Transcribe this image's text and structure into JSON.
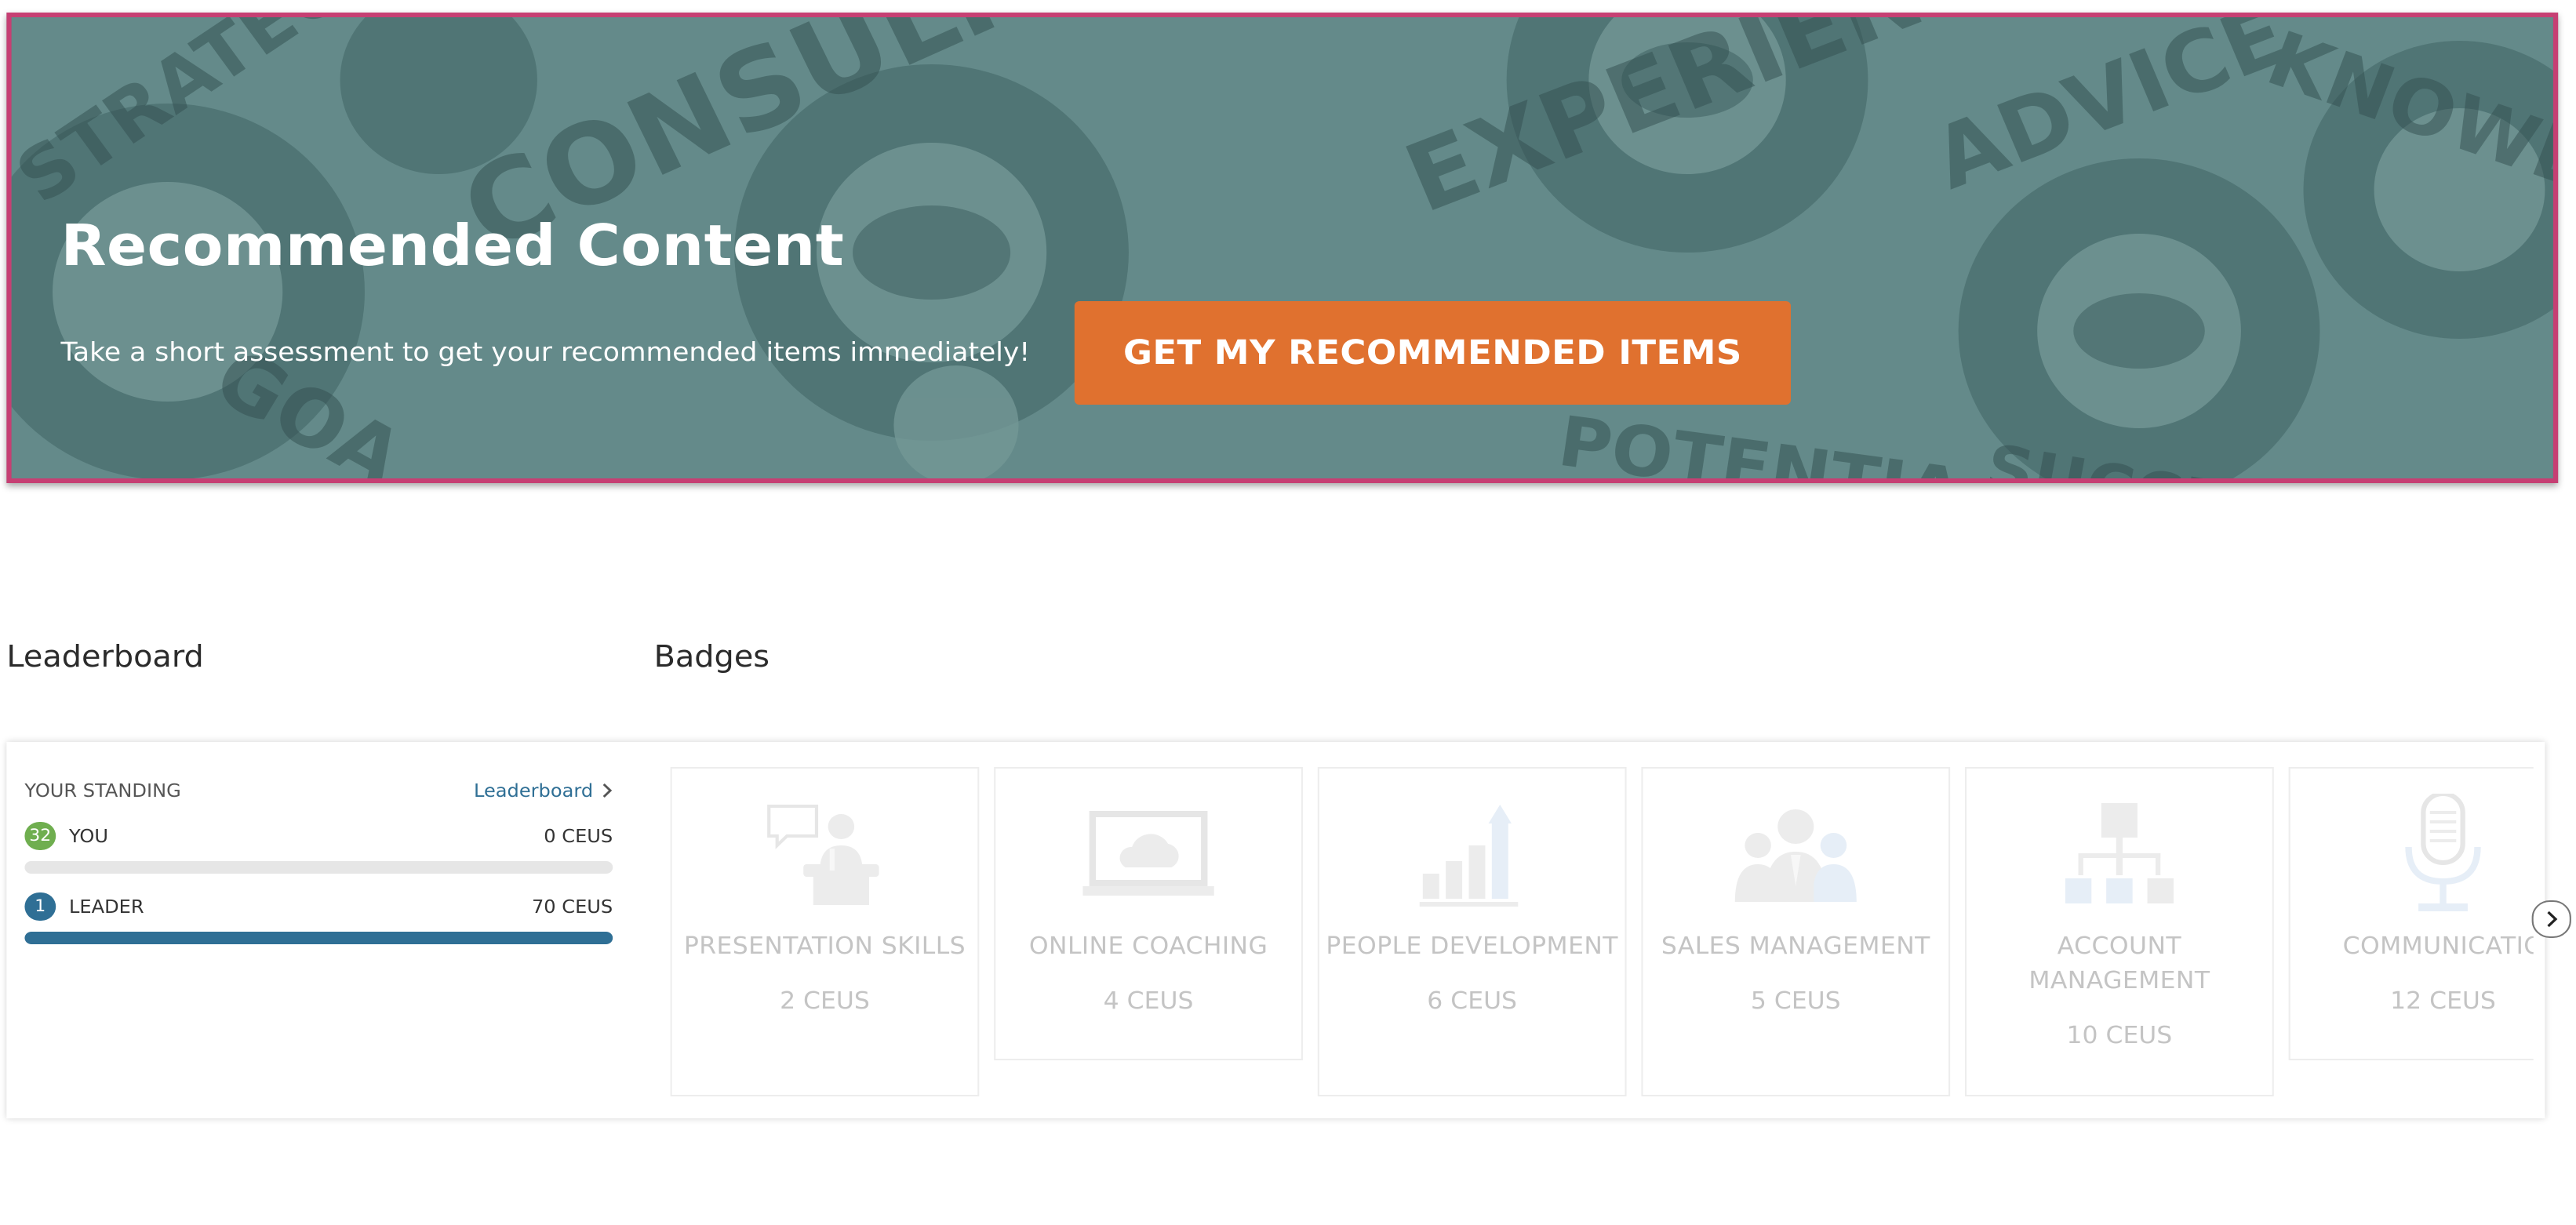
{
  "hero": {
    "title": "Recommended Content",
    "subtitle": "Take a short assessment to get your recommended items immediately!",
    "button_label": "GET MY RECOMMENDED ITEMS",
    "background_words": [
      "STRATEGY",
      "CONSULTING",
      "EXPERIENCE",
      "ADVICE",
      "KNOWLE",
      "GOA",
      "POTENTIA",
      "SUCCES"
    ],
    "colors": {
      "border": "#c63f73",
      "button": "#e0712f",
      "overlay": "#5e8584"
    }
  },
  "leaderboard": {
    "section_title": "Leaderboard",
    "standing_label": "YOUR STANDING",
    "link_label": "Leaderboard",
    "you": {
      "rank": "32",
      "label": "YOU",
      "points": "0 CEUS",
      "progress": 0,
      "rank_color": "#6fae4f"
    },
    "leader": {
      "rank": "1",
      "label": "LEADER",
      "points": "70 CEUS",
      "progress": 1,
      "rank_color": "#2f6f95"
    }
  },
  "badges": {
    "section_title": "Badges",
    "items": [
      {
        "name": "PRESENTATION SKILLS",
        "ceus": "2 CEUS",
        "icon": "presentation-icon"
      },
      {
        "name": "ONLINE COACHING",
        "ceus": "4 CEUS",
        "icon": "laptop-cloud-icon"
      },
      {
        "name": "PEOPLE DEVELOPMENT",
        "ceus": "6 CEUS",
        "icon": "growth-chart-icon"
      },
      {
        "name": "SALES MANAGEMENT",
        "ceus": "5 CEUS",
        "icon": "team-icon"
      },
      {
        "name": "ACCOUNT MANAGEMENT",
        "ceus": "10 CEUS",
        "icon": "org-chart-icon"
      },
      {
        "name": "COMMUNICATIO",
        "ceus": "12 CEUS",
        "icon": "microphone-icon"
      }
    ]
  }
}
